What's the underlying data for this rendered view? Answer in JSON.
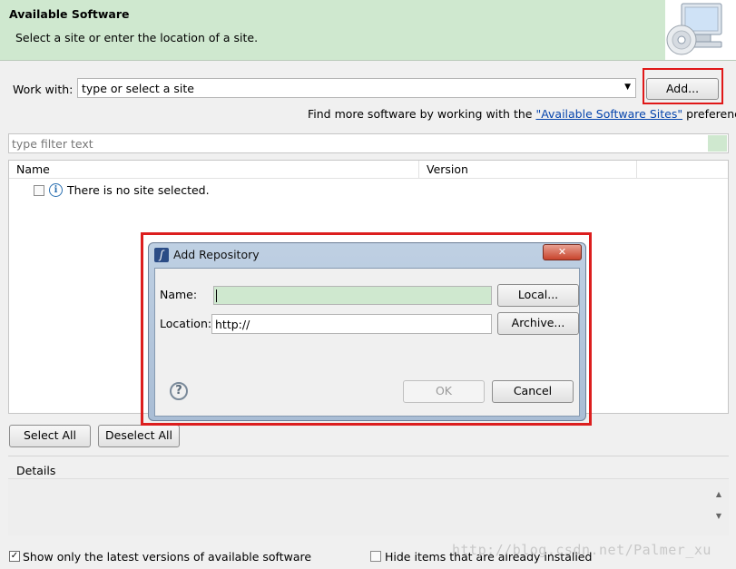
{
  "header": {
    "title": "Available Software",
    "subtitle": "Select a site or enter the location of a site."
  },
  "work_with": {
    "label": "Work with:",
    "combo_value": "type or select a site",
    "add_button": "Add..."
  },
  "find_more": {
    "prefix": "Find more software by working with the",
    "link": "\"Available Software Sites\"",
    "suffix": "preferences."
  },
  "filter": {
    "placeholder": "type filter text"
  },
  "table": {
    "columns": [
      "Name",
      "Version"
    ],
    "empty_message": "There is no site selected."
  },
  "buttons": {
    "select_all": "Select All",
    "deselect_all": "Deselect All"
  },
  "details": {
    "label": "Details"
  },
  "options": {
    "show_latest": "Show only the latest versions of available software",
    "show_latest_checked": true,
    "hide_installed": "Hide items that are already installed",
    "hide_installed_checked": false
  },
  "dialog": {
    "title": "Add Repository",
    "name_label": "Name:",
    "name_value": "",
    "location_label": "Location:",
    "location_value": "http://",
    "local_button": "Local...",
    "archive_button": "Archive...",
    "ok_button": "OK",
    "cancel_button": "Cancel",
    "close_symbol": "✕",
    "help_symbol": "?"
  },
  "watermark": "http://blog.csdn.net/Palmer_xu",
  "colors": {
    "header_bg": "#cfe8cf",
    "highlight_red": "#e01818",
    "link_blue": "#0645ad"
  }
}
